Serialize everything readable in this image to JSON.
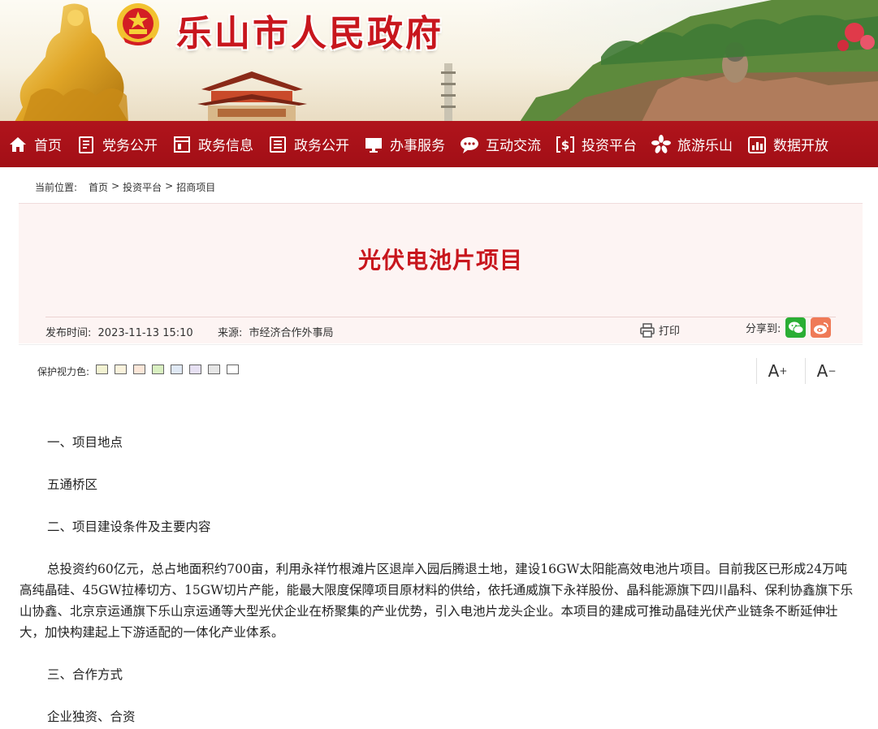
{
  "site": {
    "title": "乐山市人民政府"
  },
  "nav": {
    "items": [
      {
        "label": "首页",
        "icon": "home-icon"
      },
      {
        "label": "党务公开",
        "icon": "document-icon"
      },
      {
        "label": "政务信息",
        "icon": "window-icon"
      },
      {
        "label": "政务公开",
        "icon": "list-icon"
      },
      {
        "label": "办事服务",
        "icon": "monitor-icon"
      },
      {
        "label": "互动交流",
        "icon": "chat-icon"
      },
      {
        "label": "投资平台",
        "icon": "dollar-icon"
      },
      {
        "label": "旅游乐山",
        "icon": "flower-icon"
      },
      {
        "label": "数据开放",
        "icon": "bar-chart-icon"
      }
    ]
  },
  "breadcrumb": {
    "prefix": "当前位置:",
    "items": [
      "首页",
      "投资平台",
      "招商项目"
    ],
    "separator": ">"
  },
  "article_header": {
    "title": "光伏电池片项目",
    "publish_label": "发布时间:",
    "publish_time": "2023-11-13 15:10",
    "source_label": "来源:",
    "source": "市经济合作外事局",
    "print_label": "打印",
    "share_label": "分享到:"
  },
  "tools": {
    "eye_label": "保护视力色:",
    "swatch_colors": [
      "#f2f2d2",
      "#faf2dc",
      "#fbe6d8",
      "#d9efc1",
      "#dfe8f4",
      "#e6e0f2",
      "#e6e6e6",
      "#ffffff"
    ],
    "font_increase": "A",
    "font_increase_sup": "+",
    "font_decrease": "A",
    "font_decrease_sup": "−"
  },
  "article": {
    "paragraphs": [
      "一、项目地点",
      "五通桥区",
      "二、项目建设条件及主要内容",
      "总投资约60亿元，总占地面积约700亩，利用永祥竹根滩片区退岸入园后腾退土地，建设16GW太阳能高效电池片项目。目前我区已形成24万吨高纯晶硅、45GW拉棒切方、15GW切片产能，能最大限度保障项目原材料的供给，依托通威旗下永祥股份、晶科能源旗下四川晶科、保利协鑫旗下乐山协鑫、北京京运通旗下乐山京运通等大型光伏企业在桥聚集的产业优势，引入电池片龙头企业。本项目的建成可推动晶硅光伏产业链条不断延伸壮大，加快构建起上下游适配的一体化产业体系。",
      "三、合作方式",
      "企业独资、合资"
    ]
  },
  "colors": {
    "brand_red": "#c8161d",
    "nav_red": "#a8121a",
    "title_bg": "#fdf4f3",
    "wechat_green": "#2aae34",
    "weibo_orange": "#ef7a57"
  }
}
